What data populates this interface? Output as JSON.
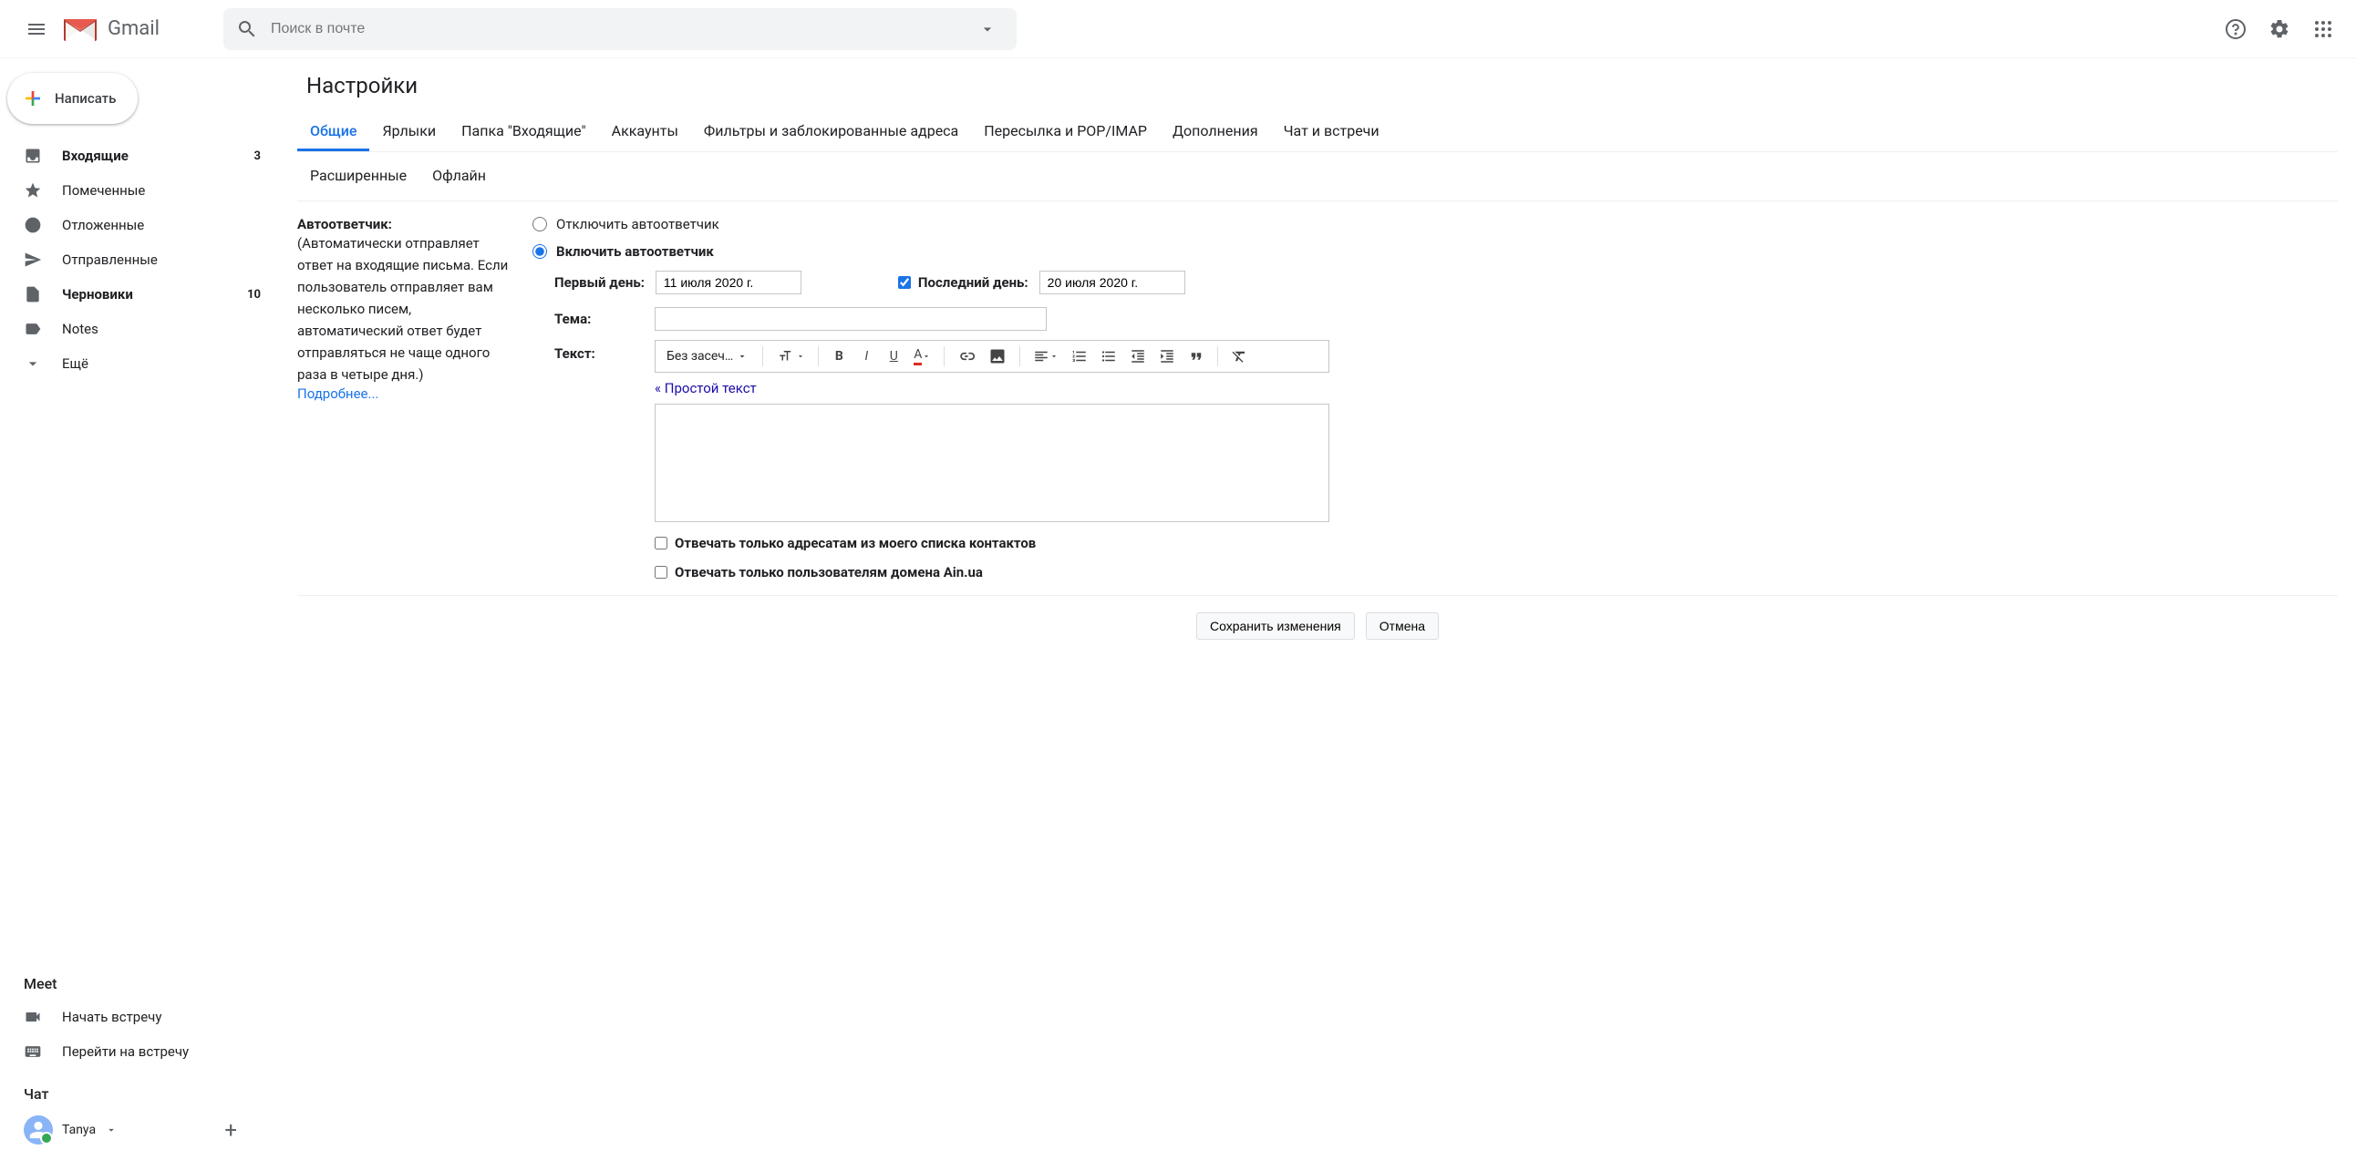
{
  "header": {
    "product": "Gmail",
    "search_placeholder": "Поиск в почте"
  },
  "compose_label": "Написать",
  "sidebar": {
    "items": [
      {
        "label": "Входящие",
        "count": "3",
        "bold": true,
        "icon": "inbox"
      },
      {
        "label": "Помеченные",
        "count": "",
        "bold": false,
        "icon": "star"
      },
      {
        "label": "Отложенные",
        "count": "",
        "bold": false,
        "icon": "clock"
      },
      {
        "label": "Отправленные",
        "count": "",
        "bold": false,
        "icon": "send"
      },
      {
        "label": "Черновики",
        "count": "10",
        "bold": true,
        "icon": "file"
      },
      {
        "label": "Notes",
        "count": "",
        "bold": false,
        "icon": "label"
      },
      {
        "label": "Ещё",
        "count": "",
        "bold": false,
        "icon": "chev"
      }
    ],
    "meet_title": "Meet",
    "meet_items": [
      {
        "label": "Начать встречу",
        "icon": "video"
      },
      {
        "label": "Перейти на встречу",
        "icon": "keyboard"
      }
    ],
    "chat_title": "Чат",
    "chat_user": "Tanya"
  },
  "page": {
    "title": "Настройки",
    "tabs_row1": [
      "Общие",
      "Ярлыки",
      "Папка \"Входящие\"",
      "Аккаунты",
      "Фильтры и заблокированные адреса",
      "Пересылка и POP/IMAP",
      "Дополнения",
      "Чат и встречи"
    ],
    "tabs_row2": [
      "Расширенные",
      "Офлайн"
    ],
    "active_tab": "Общие"
  },
  "autoresponder": {
    "title": "Автоответчик:",
    "desc": "(Автоматически отправляет ответ на входящие письма. Если пользователь отправляет вам несколько писем, автоматический ответ будет отправляться не чаще одного раза в четыре дня.)",
    "more": "Подробнее...",
    "off_label": "Отключить автоответчик",
    "on_label": "Включить автоответчик",
    "selected": "on",
    "first_day_label": "Первый день:",
    "first_day_value": "11 июля 2020 г.",
    "last_day_checked": true,
    "last_day_label": "Последний день:",
    "last_day_value": "20 июля 2020 г.",
    "subject_label": "Тема:",
    "subject_value": "",
    "text_label": "Текст:",
    "font_name": "Без засеч…",
    "plain_text_link": "« Простой текст",
    "contacts_only": "Отвечать только адресатам из моего списка контактов",
    "domain_only": "Отвечать только пользователям домена Ain.ua"
  },
  "footer": {
    "save": "Сохранить изменения",
    "cancel": "Отмена"
  }
}
